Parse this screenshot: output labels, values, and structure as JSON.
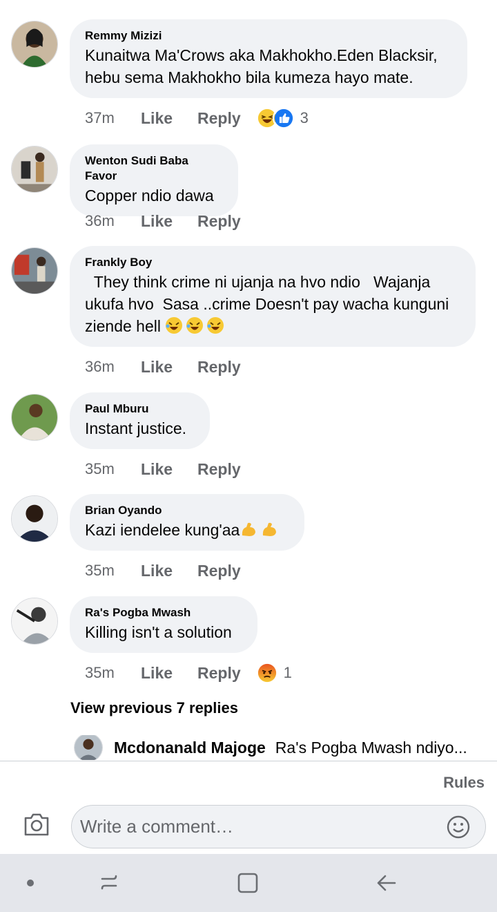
{
  "comments": [
    {
      "author": "Remmy Mizizi",
      "text": "Kunaitwa Ma'Crows aka Makhokho.Eden Blacksir, hebu sema Makhokho bila kumeza hayo mate.",
      "time": "37m",
      "like": "Like",
      "reply": "Reply",
      "reactions": [
        "laugh-reaction",
        "like-reaction"
      ],
      "reaction_count": "3"
    },
    {
      "author": "Wenton Sudi Baba Favor",
      "text": "Copper ndio dawa",
      "time": "36m",
      "like": "Like",
      "reply": "Reply"
    },
    {
      "author": "Frankly Boy",
      "text": "  They think crime ni ujanja na hvo ndio   Wajanja ukufa hvo  Sasa ..crime Doesn't pay wacha kunguni ziende hell",
      "emojis": [
        "rofl-emoji",
        "rofl-emoji",
        "rofl-emoji"
      ],
      "time": "36m",
      "like": "Like",
      "reply": "Reply"
    },
    {
      "author": "Paul Mburu",
      "text": "Instant justice.",
      "time": "35m",
      "like": "Like",
      "reply": "Reply"
    },
    {
      "author": "Brian Oyando",
      "text": "Kazi iendelee kung'aa",
      "emojis": [
        "flexed-biceps-emoji",
        "flexed-biceps-emoji"
      ],
      "time": "35m",
      "like": "Like",
      "reply": "Reply"
    },
    {
      "author": "Ra's Pogba Mwash",
      "text": "Killing isn't a solution",
      "time": "35m",
      "like": "Like",
      "reply": "Reply",
      "reactions": [
        "angry-reaction"
      ],
      "reaction_count": "1"
    }
  ],
  "view_previous": "View previous 7 replies",
  "reply_preview": {
    "author": "Mcdonanald Majoge",
    "snippet": "Ra's Pogba Mwash ndiyo..."
  },
  "composer": {
    "rules": "Rules",
    "placeholder": "Write a comment…",
    "camera_icon": "camera-icon",
    "emoji_icon": "smiley-icon"
  },
  "colors": {
    "bubble": "#f0f2f5",
    "meta_text": "#65676b",
    "like_blue": "#1877f2",
    "navbar": "#e4e6eb"
  }
}
